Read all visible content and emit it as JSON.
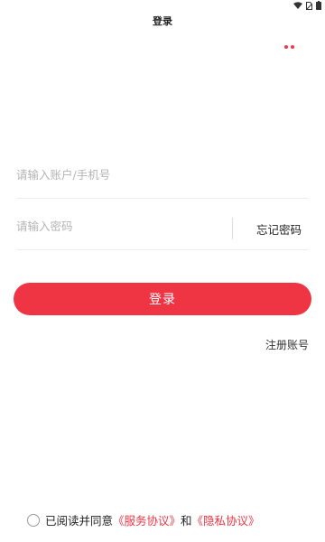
{
  "header": {
    "title": "登录"
  },
  "status_bar": {
    "icons": [
      "wifi-icon",
      "no-sim-icon",
      "battery-icon"
    ]
  },
  "menu": {
    "icon": "more-dots-icon",
    "accent": "#ef3b4a"
  },
  "form": {
    "account_placeholder": "请输入账户/手机号",
    "account_value": "",
    "password_placeholder": "请输入密码",
    "password_value": "",
    "forgot_label": "忘记密码",
    "login_label": "登录",
    "register_label": "注册账号"
  },
  "agreement": {
    "checked": false,
    "prefix": "已阅读并同意",
    "service_label": "《服务协议》",
    "connector": "和",
    "privacy_label": "《隐私协议》"
  },
  "colors": {
    "primary": "#ef3543",
    "text": "#222222",
    "placeholder": "#b4b4b4",
    "divider": "#ececec"
  }
}
